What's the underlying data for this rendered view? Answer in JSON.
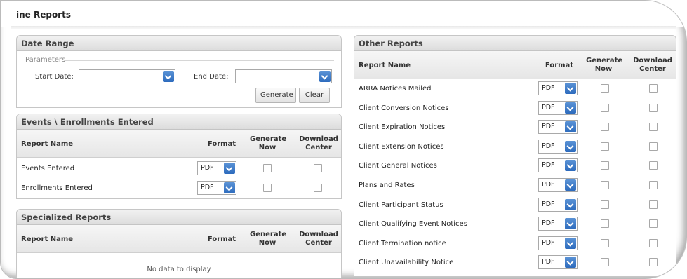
{
  "page": {
    "title": "ine Reports"
  },
  "date_range": {
    "header": "Date Range",
    "legend": "Parameters",
    "start_label": "Start Date:",
    "end_label": "End Date:",
    "start_value": "",
    "end_value": "",
    "generate_label": "Generate",
    "clear_label": "Clear"
  },
  "columns": {
    "report_name": "Report Name",
    "format": "Format",
    "generate_now": "Generate Now",
    "download_center": "Download Center"
  },
  "events": {
    "header": "Events \\ Enrollments Entered",
    "rows": [
      {
        "name": "Events Entered",
        "format": "PDF"
      },
      {
        "name": "Enrollments Entered",
        "format": "PDF"
      }
    ]
  },
  "specialized": {
    "header": "Specialized Reports",
    "empty": "No data to display"
  },
  "other": {
    "header": "Other Reports",
    "rows": [
      {
        "name": "ARRA Notices Mailed",
        "format": "PDF"
      },
      {
        "name": "Client Conversion Notices",
        "format": "PDF"
      },
      {
        "name": "Client Expiration Notices",
        "format": "PDF"
      },
      {
        "name": "Client Extension Notices",
        "format": "PDF"
      },
      {
        "name": "Client General Notices",
        "format": "PDF"
      },
      {
        "name": "Plans and Rates",
        "format": "PDF"
      },
      {
        "name": "Client Participant Status",
        "format": "PDF"
      },
      {
        "name": "Client Qualifying Event Notices",
        "format": "PDF"
      },
      {
        "name": "Client Termination notice",
        "format": "PDF"
      },
      {
        "name": "Client Unavailability Notice",
        "format": "PDF"
      }
    ]
  },
  "colors": {
    "accent": "#2d6bbd",
    "header_bg": "#e4e4e4",
    "border": "#c6c6c6"
  },
  "icons": {
    "dropdown": "chevron-down-icon",
    "checkbox": "checkbox-icon"
  }
}
